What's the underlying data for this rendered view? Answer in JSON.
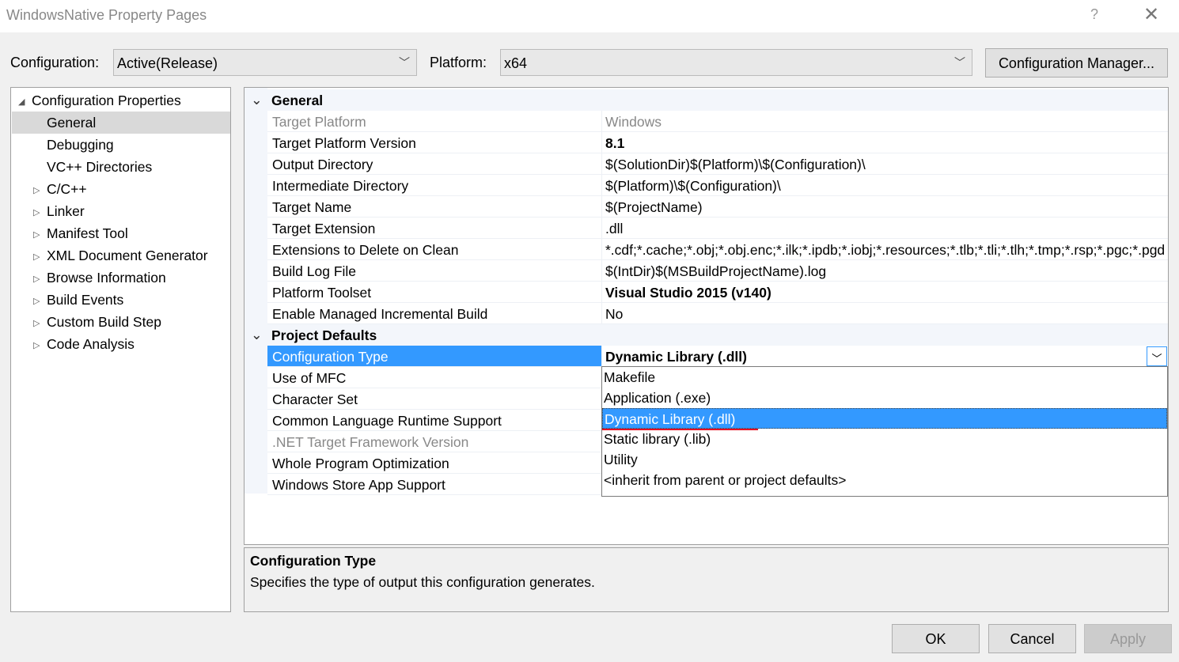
{
  "window": {
    "title": "WindowsNative Property Pages",
    "help": "?",
    "close": "✕"
  },
  "toolbar": {
    "configuration_label": "Configuration:",
    "configuration_value": "Active(Release)",
    "platform_label": "Platform:",
    "platform_value": "x64",
    "config_manager": "Configuration Manager..."
  },
  "tree": {
    "root": "Configuration Properties",
    "items": [
      "General",
      "Debugging",
      "VC++ Directories",
      "C/C++",
      "Linker",
      "Manifest Tool",
      "XML Document Generator",
      "Browse Information",
      "Build Events",
      "Custom Build Step",
      "Code Analysis"
    ],
    "selected": "General"
  },
  "grid": {
    "general": {
      "title": "General",
      "rows": [
        {
          "name": "Target Platform",
          "value": "Windows"
        },
        {
          "name": "Target Platform Version",
          "value": "8.1"
        },
        {
          "name": "Output Directory",
          "value": "$(SolutionDir)$(Platform)\\$(Configuration)\\"
        },
        {
          "name": "Intermediate Directory",
          "value": "$(Platform)\\$(Configuration)\\"
        },
        {
          "name": "Target Name",
          "value": "$(ProjectName)"
        },
        {
          "name": "Target Extension",
          "value": ".dll"
        },
        {
          "name": "Extensions to Delete on Clean",
          "value": "*.cdf;*.cache;*.obj;*.obj.enc;*.ilk;*.ipdb;*.iobj;*.resources;*.tlb;*.tli;*.tlh;*.tmp;*.rsp;*.pgc;*.pgd"
        },
        {
          "name": "Build Log File",
          "value": "$(IntDir)$(MSBuildProjectName).log"
        },
        {
          "name": "Platform Toolset",
          "value": "Visual Studio 2015 (v140)"
        },
        {
          "name": "Enable Managed Incremental Build",
          "value": "No"
        }
      ]
    },
    "defaults": {
      "title": "Project Defaults",
      "rows": [
        {
          "name": "Configuration Type",
          "value": "Dynamic Library (.dll)"
        },
        {
          "name": "Use of MFC",
          "value": ""
        },
        {
          "name": "Character Set",
          "value": ""
        },
        {
          "name": "Common Language Runtime Support",
          "value": ""
        },
        {
          "name": ".NET Target Framework Version",
          "value": ""
        },
        {
          "name": "Whole Program Optimization",
          "value": ""
        },
        {
          "name": "Windows Store App Support",
          "value": ""
        }
      ]
    }
  },
  "dropdown": {
    "options": [
      "Makefile",
      "Application (.exe)",
      "Dynamic Library (.dll)",
      "Static library (.lib)",
      "Utility",
      "<inherit from parent or project defaults>"
    ],
    "selected": "Dynamic Library (.dll)"
  },
  "description": {
    "title": "Configuration Type",
    "text": "Specifies the type of output this configuration generates."
  },
  "buttons": {
    "ok": "OK",
    "cancel": "Cancel",
    "apply": "Apply"
  },
  "colors": {
    "selection": "#3399ff",
    "section_bg": "#f3f6fb"
  }
}
